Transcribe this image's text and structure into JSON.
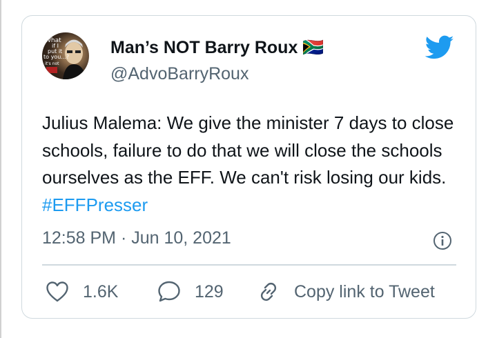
{
  "tweet": {
    "display_name": "Man’s NOT Barry Roux 🇿🇦",
    "handle": "@AdvoBarryRoux",
    "text_main": "Julius Malema: We give the minister 7 days to close schools, failure to do that we will close the schools ourselves as the EFF. We can't risk losing our kids.",
    "hashtag": "#EFFPresser",
    "timestamp": "12:58 PM · Jun 10, 2021",
    "avatar_text": [
      "What",
      "if I",
      "put it",
      "to you...?",
      "it's not"
    ]
  },
  "actions": {
    "likes": "1.6K",
    "replies": "129",
    "copy_link": "Copy link to Tweet"
  },
  "colors": {
    "brand": "#1d9bf0",
    "text": "#0f1419",
    "secondary": "#536471",
    "border": "#cfd9de"
  }
}
